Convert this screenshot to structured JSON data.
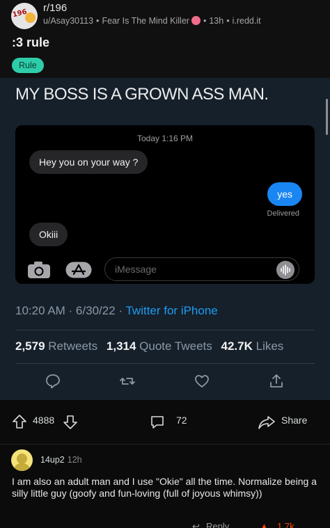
{
  "post": {
    "subreddit": "r/196",
    "author": "u/Asay30113",
    "author_flair": "Fear Is The Mind Killer",
    "age": "13h",
    "domain": "i.redd.it",
    "title": ":3 rule",
    "flair": "Rule"
  },
  "tweet": {
    "text": "MY BOSS IS A GROWN ASS MAN.",
    "imessage": {
      "timestamp": "Today 1:16 PM",
      "messages": [
        {
          "from": "them",
          "text": "Hey you on your way ?"
        },
        {
          "from": "me",
          "text": "yes"
        },
        {
          "from": "them",
          "text": "Okiii"
        }
      ],
      "delivered": "Delivered",
      "input_placeholder": "iMessage"
    },
    "time": "10:20 AM · 6/30/22 · ",
    "source": "Twitter for iPhone",
    "retweets_count": "2,579",
    "retweets_label": "Retweets",
    "quotes_count": "1,314",
    "quotes_label": "Quote Tweets",
    "likes_count": "42.7K",
    "likes_label": "Likes"
  },
  "actions": {
    "score": "4888",
    "comments": "72",
    "share": "Share"
  },
  "comment": {
    "user": "14up2",
    "age": "12h",
    "text": "I am also an adult man and I use \"Okie\" all the time. Normalize being a silly little guy (goofy and fun-loving (full of joyous whimsy))",
    "reply": "Reply",
    "score": "1.7k"
  },
  "colors": {
    "flair_bg": "#2ecda9",
    "tweet_bg": "#15202b",
    "imessage_blue": "#1a86f4",
    "twitter_blue": "#1d9bf0",
    "upvote_orange": "#ff4500"
  },
  "icons": [
    "subreddit-avatar",
    "camera-icon",
    "app-store-icon",
    "audio-wave-icon",
    "reply-icon",
    "retweet-icon",
    "heart-icon",
    "share-icon",
    "upvote-icon",
    "downvote-icon",
    "comment-icon",
    "reddit-share-icon",
    "user-avatar"
  ]
}
